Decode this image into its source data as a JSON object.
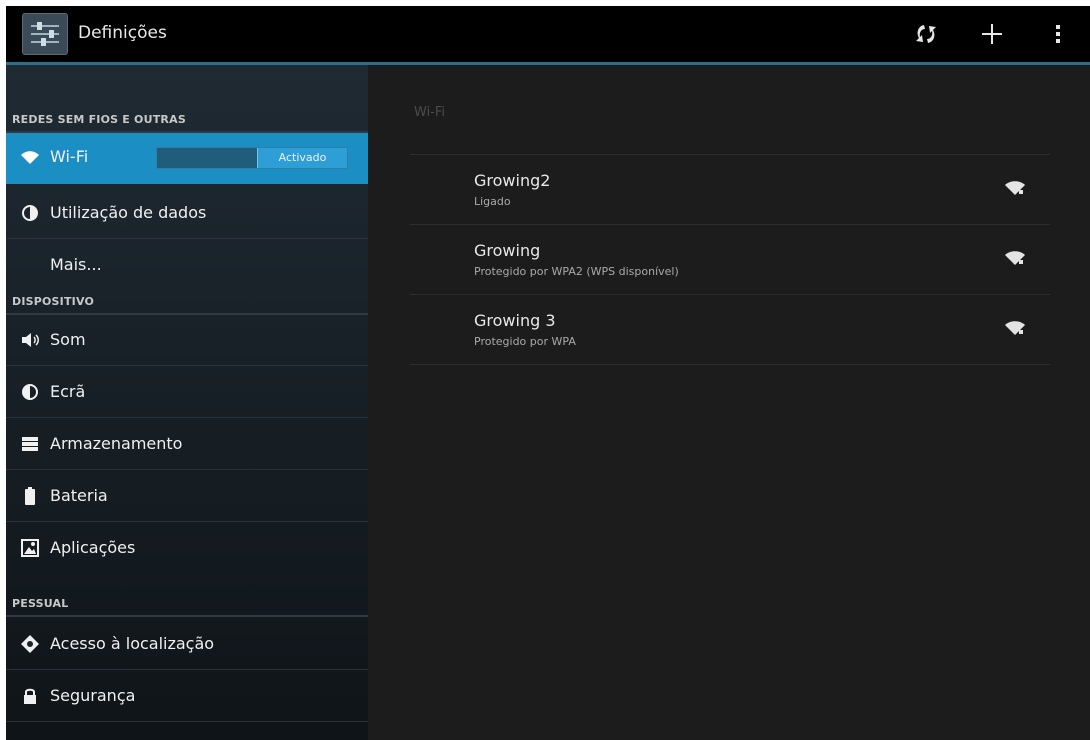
{
  "actionbar": {
    "title": "Definições",
    "icons": [
      "settings-app-icon",
      "wps-icon",
      "add-icon",
      "overflow-menu-icon"
    ]
  },
  "sidebar": {
    "sections": [
      {
        "label": "REDES SEM FIOS E OUTRAS"
      },
      {
        "label": "DISPOSITIVO"
      },
      {
        "label": "PESSUAL"
      }
    ],
    "items": [
      {
        "label": "Wi-Fi",
        "icon": "wifi-icon",
        "toggle": "Activado"
      },
      {
        "label": "Utilização de dados",
        "icon": "data-usage-icon"
      },
      {
        "label": "Mais..."
      },
      {
        "label": "Som",
        "icon": "speaker-icon"
      },
      {
        "label": "Ecrã",
        "icon": "brightness-icon"
      },
      {
        "label": "Armazenamento",
        "icon": "storage-icon"
      },
      {
        "label": "Bateria",
        "icon": "battery-icon"
      },
      {
        "label": "Aplicações",
        "icon": "apps-icon"
      },
      {
        "label": "Acesso à localização",
        "icon": "location-icon"
      },
      {
        "label": "Segurança",
        "icon": "lock-icon"
      }
    ]
  },
  "wifi": {
    "title": "Wi-Fi",
    "networks": [
      {
        "name": "Growing2",
        "status": "Ligado"
      },
      {
        "name": "Growing",
        "status": "Protegido por WPA2 (WPS disponível)"
      },
      {
        "name": "Growing 3",
        "status": "Protegido por WPA"
      }
    ]
  },
  "colors": {
    "accent": "#1b8fc4",
    "actionbar": "#000000",
    "divider": "#2b6f8e"
  }
}
